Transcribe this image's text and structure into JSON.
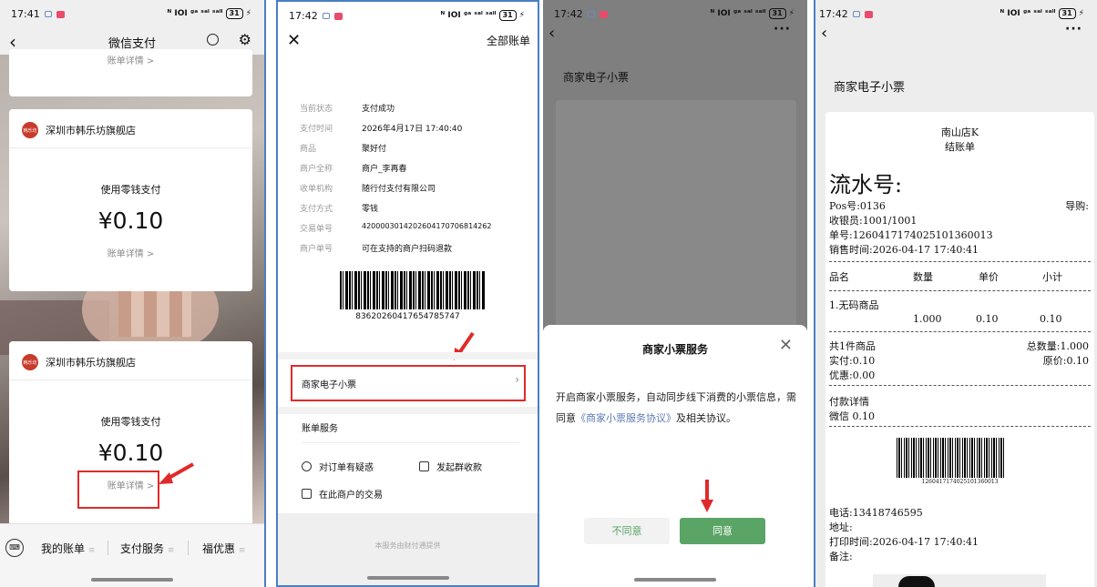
{
  "status_bars": [
    {
      "time": "17:41",
      "right": "ᴺ ⅠOⅠ ᵍᵃ ˢᵃˡ ˢᵃˡˡ",
      "battery": "31"
    },
    {
      "time": "17:42",
      "right": "ᴺ ⅠOⅠ ᵍᵃ ˢᵃˡ ˢᵃˡˡ",
      "battery": "31"
    },
    {
      "time": "17:42",
      "right": "ᴺ ⅠOⅠ ᵍᵃ ˢᵃˡ ˢᵃˡˡ",
      "battery": "31"
    },
    {
      "time": "17:42",
      "right": "ᴺ ⅠOⅠ ᵍᵃ ˢᵃˡ ˢᵃˡˡ",
      "battery": "31"
    }
  ],
  "p1": {
    "title": "微信支付",
    "top_card_detail": "账单详情 >",
    "cards": [
      {
        "shop": "深圳市韩乐坊旗舰店",
        "logo_text": "韩乐坊",
        "pay": "使用零钱支付",
        "amount": "¥0.10",
        "detail": "账单详情 >"
      },
      {
        "shop": "深圳市韩乐坊旗舰店",
        "logo_text": "韩乐坊",
        "pay": "使用零钱支付",
        "amount": "¥0.10",
        "detail": "账单详情 >"
      }
    ],
    "tabs": [
      "我的账单",
      "支付服务",
      "福优惠"
    ],
    "tab_suffix": "≡"
  },
  "p2": {
    "header_right": "全部账单",
    "rows": [
      {
        "k": "当前状态",
        "v": "支付成功"
      },
      {
        "k": "支付时间",
        "v": "2026年4月17日 17:40:40"
      },
      {
        "k": "商品",
        "v": "聚好付"
      },
      {
        "k": "商户全称",
        "v": "商户_李再春"
      },
      {
        "k": "收单机构",
        "v": "随行付支付有限公司"
      },
      {
        "k": "支付方式",
        "v": "零钱"
      },
      {
        "k": "交易单号",
        "v": "4200003014202604170706814262"
      },
      {
        "k": "商户单号",
        "v": "可在支持的商户扫码退款"
      }
    ],
    "barcode_number": "83620260417654785747",
    "receipt_label": "商家电子小票",
    "services_title": "账单服务",
    "actions": [
      "对订单有疑惑",
      "发起群收款",
      "在此商户的交易"
    ],
    "footer": "本服务由财付通提供"
  },
  "p3": {
    "title": "商家电子小票",
    "sheet_title": "商家小票服务",
    "body_1": "开启商家小票服务，自动同步线下消费的小票信息，需同意",
    "body_link": "《商家小票服务协议》",
    "body_2": "及相关协议。",
    "decline": "不同意",
    "accept": "同意"
  },
  "p4": {
    "title": "商家电子小票",
    "store": "南山店K",
    "doc": "结账单",
    "serial": "流水号:",
    "pos": "Pos号:0136",
    "guide": "导购:",
    "cashier": "收银员:1001/1001",
    "order": "单号:126041717402510136001З",
    "sale_time": "销售时间:2026-04-17 17:40:41",
    "cols": [
      "品名",
      "数量",
      "单价",
      "小计"
    ],
    "item_name": "1.无码商品",
    "item_qty": "1.000",
    "item_price": "0.10",
    "item_sub": "0.10",
    "total_items": "共1件商品",
    "total_qty": "总数量:1.000",
    "paid": "实付:0.10",
    "orig": "原价:0.10",
    "discount": "优惠:0.00",
    "pay_detail": "付款详情",
    "wechat": "微信 0.10",
    "barcode_num": "126041717402510136001З",
    "phone": "电话:13418746595",
    "address": "地址:",
    "print_time": "打印时间:2026-04-17 17:40:41",
    "note": "备注:"
  }
}
